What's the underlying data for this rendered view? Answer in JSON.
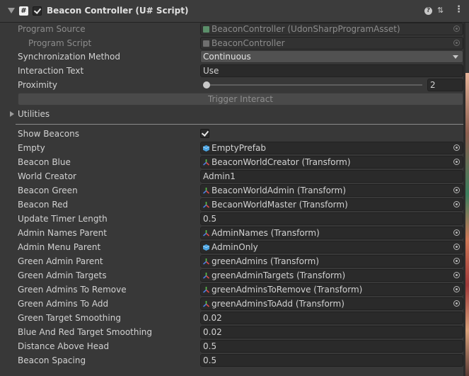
{
  "header": {
    "title": "Beacon Controller (U# Script)",
    "script_glyph": "#",
    "icons": [
      "expand-arrow-icon",
      "script-icon",
      "enabled-checkbox",
      "help-icon",
      "preset-icon",
      "context-menu-icon"
    ]
  },
  "rows": {
    "program_source": {
      "label": "Program Source",
      "value": "BeaconController (UdonSharpProgramAsset)"
    },
    "program_script": {
      "label": "Program Script",
      "value": "BeaconController"
    },
    "sync_method": {
      "label": "Synchronization Method",
      "value": "Continuous"
    },
    "interaction_text": {
      "label": "Interaction Text",
      "value": "Use"
    },
    "proximity": {
      "label": "Proximity",
      "value": "2",
      "slider_fraction": 0.0
    },
    "trigger_interact": {
      "label": "Trigger Interact"
    },
    "utilities": {
      "label": "Utilities"
    },
    "show_beacons": {
      "label": "Show Beacons",
      "checked": true
    },
    "empty": {
      "label": "Empty",
      "value": "EmptyPrefab",
      "icon": "prefab-icon"
    },
    "beacon_blue": {
      "label": "Beacon Blue",
      "value": "BeaconWorldCreator (Transform)",
      "icon": "transform-icon"
    },
    "world_creator": {
      "label": "World Creator",
      "value": "Admin1"
    },
    "beacon_green": {
      "label": "Beacon Green",
      "value": "BeaconWorldAdmin (Transform)",
      "icon": "transform-icon"
    },
    "beacon_red": {
      "label": "Beacon Red",
      "value": "BecaonWorldMaster (Transform)",
      "icon": "transform-icon"
    },
    "update_timer": {
      "label": "Update Timer Length",
      "value": "0.5"
    },
    "admin_names_parent": {
      "label": "Admin Names Parent",
      "value": "AdminNames (Transform)",
      "icon": "transform-icon"
    },
    "admin_menu_parent": {
      "label": "Admin Menu Parent",
      "value": "AdminOnly",
      "icon": "prefab-icon"
    },
    "green_admin_parent": {
      "label": "Green Admin Parent",
      "value": "greenAdmins (Transform)",
      "icon": "transform-icon"
    },
    "green_admin_targets": {
      "label": "Green Admin Targets",
      "value": "greenAdminTargets (Transform)",
      "icon": "transform-icon"
    },
    "green_admins_remove": {
      "label": "Green Admins To Remove",
      "value": "greenAdminsToRemove (Transform)",
      "icon": "transform-icon"
    },
    "green_admins_add": {
      "label": "Green Admins To Add",
      "value": "greenAdminsToAdd (Transform)",
      "icon": "transform-icon"
    },
    "green_target_smoothing": {
      "label": "Green Target Smoothing",
      "value": "0.02"
    },
    "blue_red_smoothing": {
      "label": "Blue And Red Target Smoothing",
      "value": "0.02"
    },
    "distance_above_head": {
      "label": "Distance Above Head",
      "value": "0.5"
    },
    "beacon_spacing": {
      "label": "Beacon Spacing",
      "value": "0.5"
    }
  },
  "colors": {
    "panel": "#383838",
    "field": "#2a2a2a",
    "prefab_icon": "#4aa3e0",
    "transform_red": "#e04848",
    "transform_green": "#5cc24a",
    "transform_blue": "#4a7de0"
  }
}
